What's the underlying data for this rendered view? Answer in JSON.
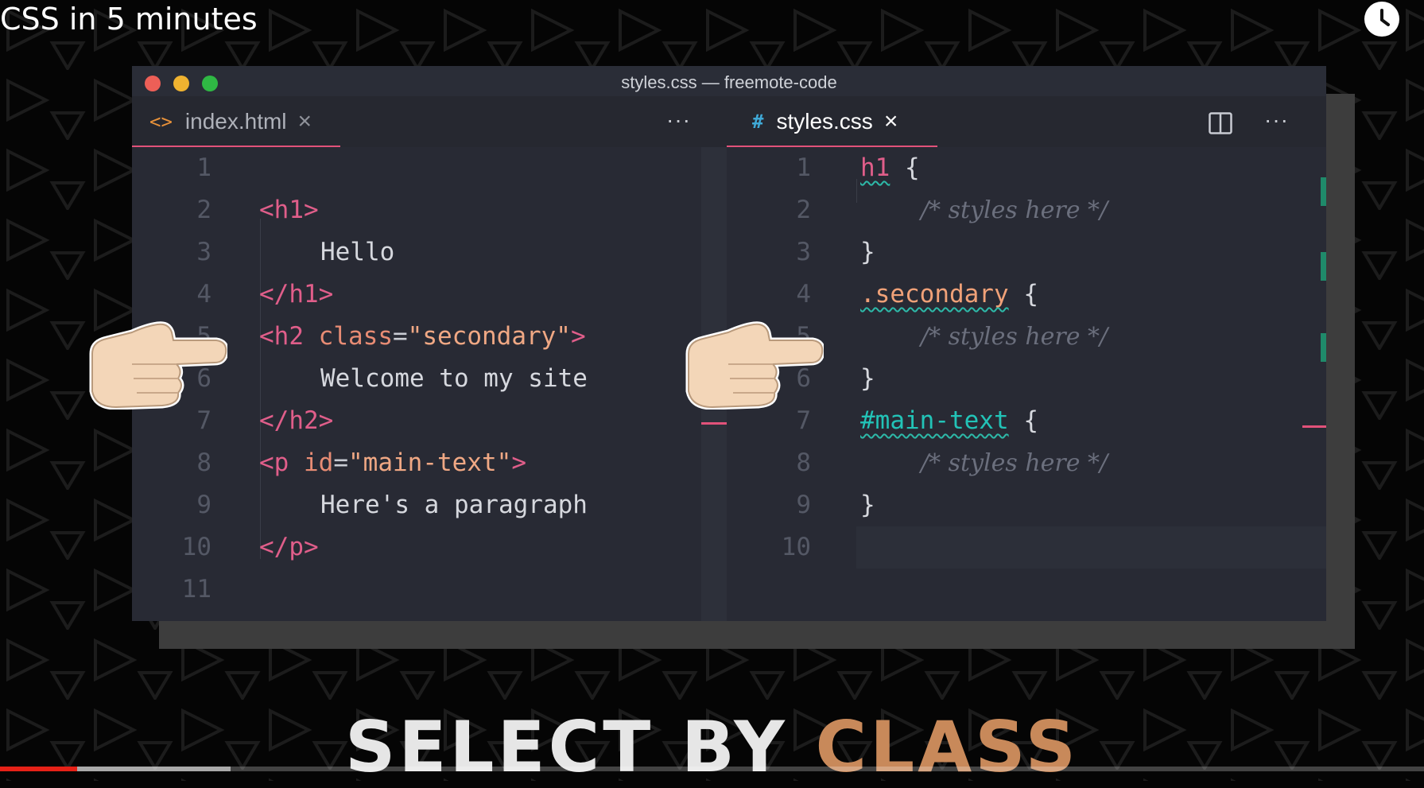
{
  "video": {
    "title": "CSS in 5 minutes",
    "progress_fraction": 0.054,
    "buffered_fraction": 0.162
  },
  "window": {
    "title": "styles.css — freemote-code"
  },
  "left_pane": {
    "tab": {
      "icon": "<>",
      "label": "index.html",
      "close": "×"
    },
    "more_label": "···",
    "line_numbers": [
      "1",
      "2",
      "3",
      "4",
      "5",
      "6",
      "7",
      "8",
      "9",
      "10",
      "11"
    ],
    "code": {
      "l2_tag": "<h1>",
      "l3_text": "Hello",
      "l4_tag": "</h1>",
      "l5_open": "<h2",
      "l5_attr": "class",
      "l5_eq": "=",
      "l5_val": "\"secondary\"",
      "l5_close": ">",
      "l6_text": "Welcome to my site",
      "l7_tag": "</h2>",
      "l8_open": "<p",
      "l8_attr": "id",
      "l8_eq": "=",
      "l8_val": "\"main-text\"",
      "l8_close": ">",
      "l9_text": "Here's a paragraph",
      "l10_tag": "</p>"
    }
  },
  "right_pane": {
    "tab": {
      "icon": "#",
      "label": "styles.css",
      "close": "×"
    },
    "more_label": "···",
    "line_numbers": [
      "1",
      "2",
      "3",
      "4",
      "5",
      "6",
      "7",
      "8",
      "9",
      "10"
    ],
    "code": {
      "l1_sel": "h1",
      "l1_brace": "{",
      "l2_comment": "/* styles here */",
      "l3_brace": "}",
      "l4_sel": ".secondary",
      "l4_brace": "{",
      "l5_comment": "/* styles here */",
      "l6_brace": "}",
      "l7_sel": "#main-text",
      "l7_brace": "{",
      "l8_comment": "/* styles here */",
      "l9_brace": "}"
    }
  },
  "caption": {
    "part1": "SELECT BY ",
    "part2": "CLASS"
  },
  "colors": {
    "tag": "#e05e8a",
    "class_selector": "#f0a178",
    "id_selector": "#22c3b7",
    "caption_white": "#e6e6e6",
    "caption_accent": "#c8895a",
    "progress": "#e62117"
  }
}
